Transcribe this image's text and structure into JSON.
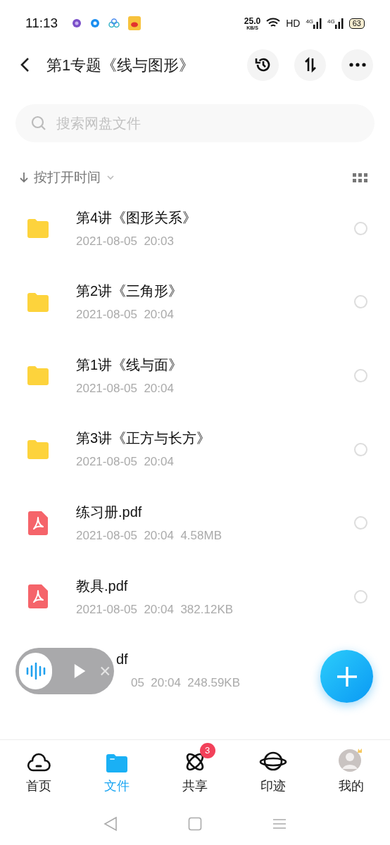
{
  "status_bar": {
    "time": "11:13",
    "speed": "25.0",
    "speed_unit": "KB/S",
    "hd": "HD",
    "networks": [
      "4G",
      "4G"
    ],
    "battery": "63"
  },
  "header": {
    "title": "第1专题《线与图形》"
  },
  "search": {
    "placeholder": "搜索网盘文件"
  },
  "sort": {
    "label": "按打开时间"
  },
  "files": [
    {
      "kind": "folder",
      "name": "第4讲《图形关系》",
      "meta": "2021-08-05  20:03",
      "selected": false
    },
    {
      "kind": "folder",
      "name": "第2讲《三角形》",
      "meta": "2021-08-05  20:04",
      "selected": false
    },
    {
      "kind": "folder",
      "name": "第1讲《线与面》",
      "meta": "2021-08-05  20:04",
      "selected": false
    },
    {
      "kind": "folder",
      "name": "第3讲《正方与长方》",
      "meta": "2021-08-05  20:04",
      "selected": false
    },
    {
      "kind": "pdf",
      "name": "练习册.pdf",
      "meta": "2021-08-05  20:04  4.58MB",
      "selected": false
    },
    {
      "kind": "pdf",
      "name": "教具.pdf",
      "meta": "2021-08-05  20:04  382.12KB",
      "selected": false
    },
    {
      "kind": "covered",
      "name": "df",
      "meta": "05  20:04  248.59KB"
    }
  ],
  "tabs": [
    {
      "kind": "home",
      "label": "首页",
      "selected": false
    },
    {
      "kind": "files",
      "label": "文件",
      "selected": true
    },
    {
      "kind": "share",
      "label": "共享",
      "selected": false,
      "badge": "3"
    },
    {
      "kind": "trace",
      "label": "印迹",
      "selected": false
    },
    {
      "kind": "me",
      "label": "我的",
      "selected": false
    }
  ]
}
